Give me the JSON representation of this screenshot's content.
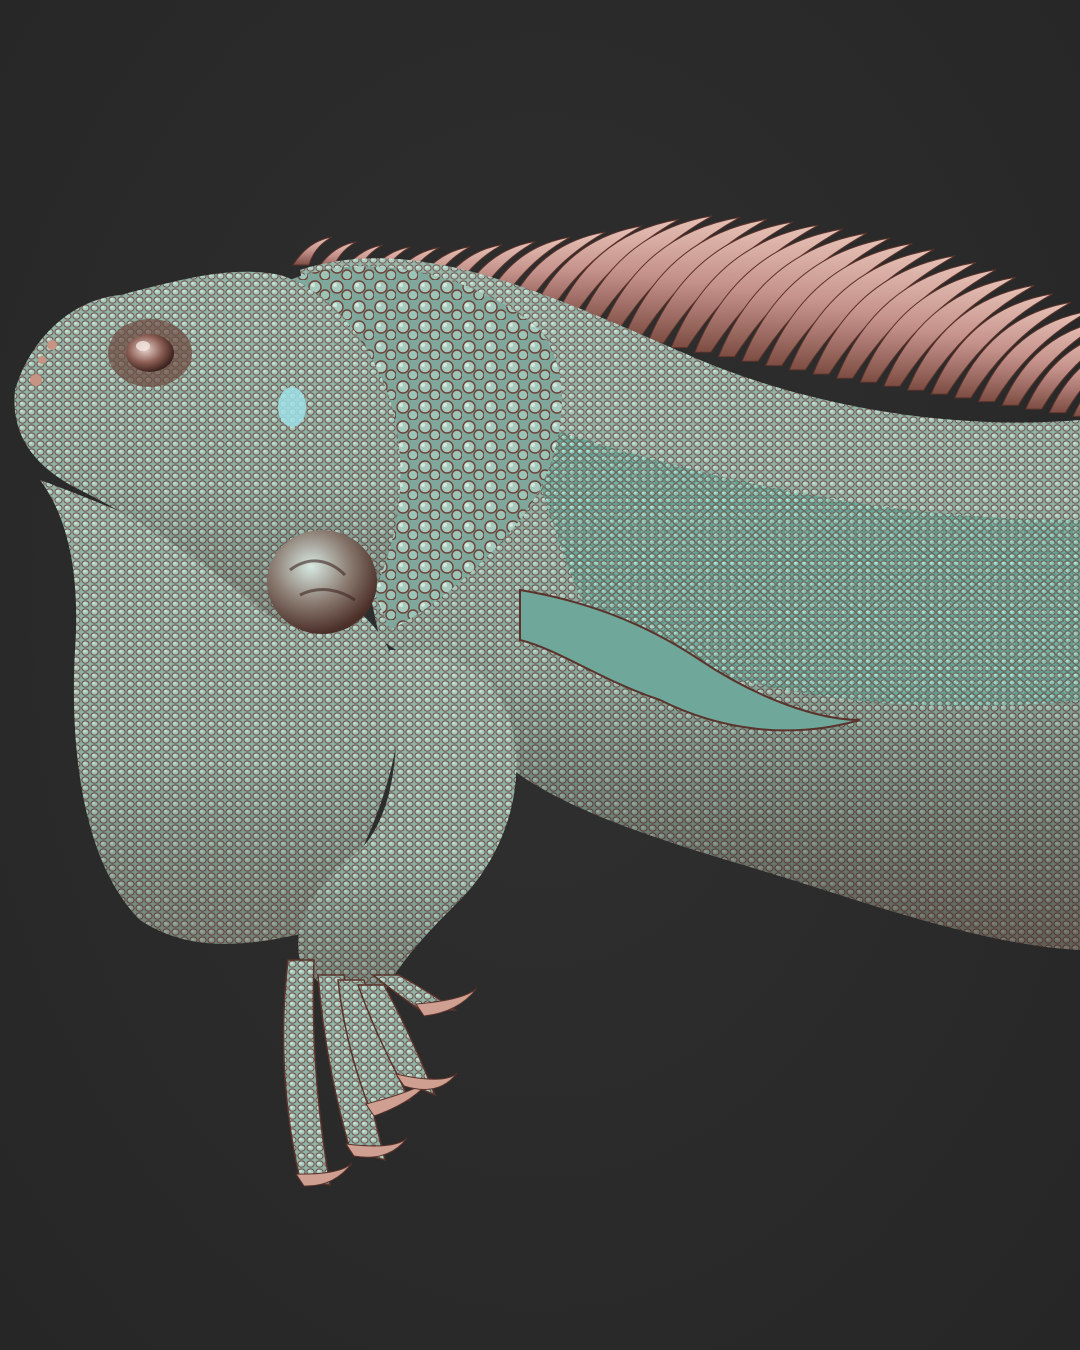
{
  "scene": {
    "subject": "iguana-sculpt",
    "colors": {
      "background": "#2b2b2b",
      "skin_base": "#8fb3a8",
      "skin_teal": "#5fc2b2",
      "skin_copper": "#b87a66",
      "shadow": "#3a2a26",
      "spine": "#c79484"
    }
  }
}
